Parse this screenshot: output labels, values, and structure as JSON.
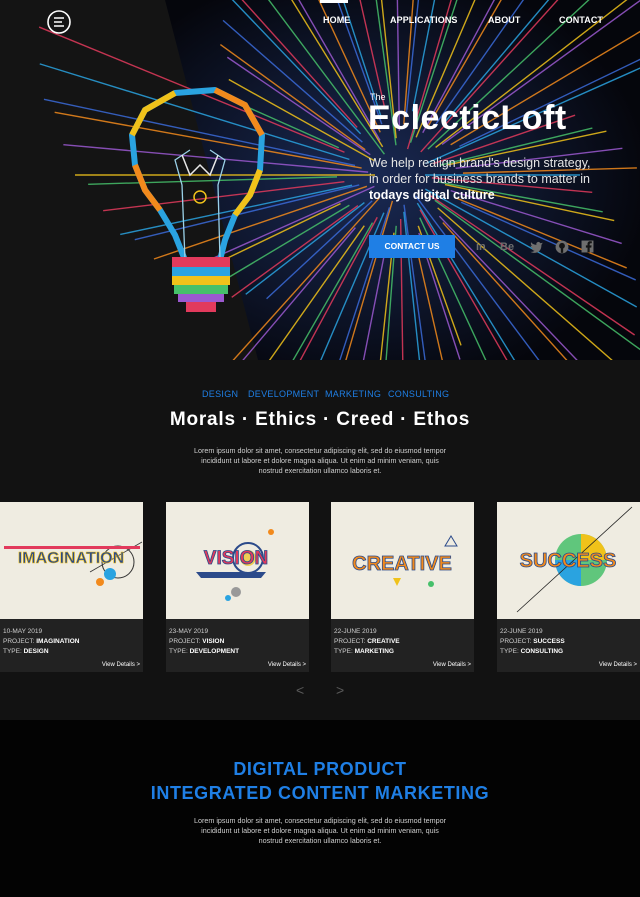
{
  "nav": {
    "items": [
      {
        "label": "HOME",
        "active": true
      },
      {
        "label": "APPLICATIONS",
        "active": false
      },
      {
        "label": "ABOUT",
        "active": false
      },
      {
        "label": "CONTACT",
        "active": false
      }
    ],
    "logo_icon": "e-logo-icon"
  },
  "hero": {
    "pre_title": "The",
    "title": "EclecticLoft",
    "desc_line1": "We help realign brand's design strategy,",
    "desc_line2": "in order for business brands to matter in",
    "desc_line3": "todays digital culture",
    "cta_label": "CONTACT US",
    "socials": [
      "linkedin-icon",
      "behance-icon",
      "twitter-icon",
      "github-icon",
      "facebook-icon"
    ],
    "social_labels": {
      "linkedin": "in",
      "behance": "Be"
    }
  },
  "categories": [
    "DESIGN",
    "DEVELOPMENT",
    "MARKETING",
    "CONSULTING"
  ],
  "morals": "Morals  ·  Ethics  ·  Creed  ·  Ethos",
  "lorem": {
    "line1": "Lorem ipsum dolor sit amet, consectetur adipiscing elit, sed do eiusmod tempor",
    "line2": "incididunt ut labore et dolore magna aliqua. Ut enim ad minim veniam, quis",
    "line3": "nostrud exercitation ullamco laboris et."
  },
  "cards": [
    {
      "art": "IMAGINATION",
      "date": "10-MAY 2019",
      "project_label": "PROJECT:",
      "project": "IMAGINATION",
      "type_label": "TYPE:",
      "type": "DESIGN",
      "details": "View Details >"
    },
    {
      "art": "VISION",
      "date": "23-MAY 2019",
      "project_label": "PROJECT:",
      "project": "VISION",
      "type_label": "TYPE:",
      "type": "DEVELOPMENT",
      "details": "View Details >"
    },
    {
      "art": "CREATIVE",
      "date": "22-JUNE 2019",
      "project_label": "PROJECT:",
      "project": "CREATIVE",
      "type_label": "TYPE:",
      "type": "MARKETING",
      "details": "View Details >"
    },
    {
      "art": "SUCCESS",
      "date": "22-JUNE 2019",
      "project_label": "PROJECT:",
      "project": "SUCCESS",
      "type_label": "TYPE:",
      "type": "CONSULTING",
      "details": "View Details >"
    }
  ],
  "carousel": {
    "prev": "<",
    "next": ">"
  },
  "digital": {
    "line1": "DIGITAL PRODUCT",
    "line2": "INTEGRATED CONTENT MARKETING"
  },
  "colors": {
    "accent": "#1f7fe5",
    "background": "#121212",
    "footer_bg": "#030303"
  }
}
